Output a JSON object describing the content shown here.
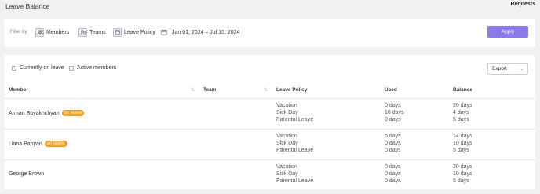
{
  "page": {
    "title": "Leave Balance",
    "requests_link": "Requests"
  },
  "filters": {
    "label": "Filter by:",
    "members": "Members",
    "teams": "Teams",
    "leave_policy": "Leave Policy",
    "date_range": "Jan 01, 2024 – Jul 15, 2024",
    "apply": "Apply"
  },
  "toggles": {
    "currently_on_leave": "Currently on leave",
    "active_members": "Active members"
  },
  "export": {
    "label": "Export"
  },
  "table": {
    "headers": {
      "member": "Member",
      "team": "Team",
      "leave_policy": "Leave Policy",
      "used": "Used",
      "balance": "Balance"
    },
    "rows": [
      {
        "member": "Arman Boyakhchyan",
        "badge": "on leave",
        "team": "",
        "policies": [
          "Vacation",
          "Sick Day",
          "Parental Leave"
        ],
        "used": [
          "0 days",
          "16 days",
          "0 days"
        ],
        "balance": [
          "20 days",
          "4 days",
          "5 days"
        ]
      },
      {
        "member": "Liana Papyan",
        "badge": "on leave",
        "team": "",
        "policies": [
          "Vacation",
          "Sick Day",
          "Parental Leave"
        ],
        "used": [
          "6 days",
          "0 days",
          "0 days"
        ],
        "balance": [
          "14 days",
          "10 days",
          "5 days"
        ]
      },
      {
        "member": "George Brown",
        "badge": "",
        "team": "",
        "policies": [
          "Vacation",
          "Sick Day",
          "Parental Leave"
        ],
        "used": [
          "0 days",
          "0 days",
          "0 days"
        ],
        "balance": [
          "20 days",
          "10 days",
          "5 days"
        ]
      }
    ]
  },
  "colors": {
    "accent": "#8b78ea",
    "badge": "#f0a020",
    "background": "#f1f1f3"
  }
}
